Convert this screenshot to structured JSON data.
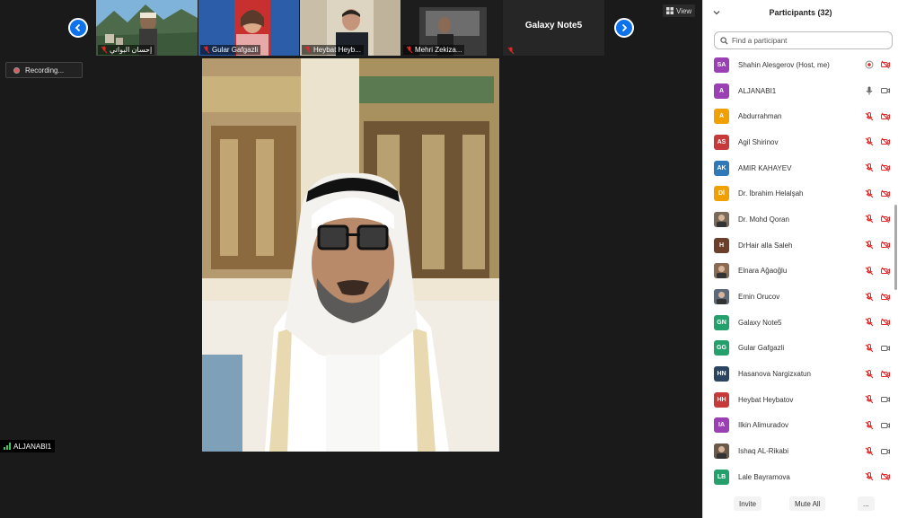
{
  "view_button": {
    "label": "View"
  },
  "recording": {
    "label": "Recording..."
  },
  "thumbnails": [
    {
      "name": "إحسان البواتي"
    },
    {
      "name": "Gular Gafgazli"
    },
    {
      "name": "Heybat Heyb..."
    },
    {
      "name": "Mehri Zekiza..."
    },
    {
      "name": "Galaxy Note5"
    }
  ],
  "main_video": {
    "speaker": "ALJANABI1"
  },
  "panel": {
    "title": "Participants (32)",
    "search_placeholder": "Find a participant",
    "participants": [
      {
        "initials": "SA",
        "name": "Shahin Alesgerov (Host, me)",
        "color": "#9b3fb5",
        "mic": "share",
        "cam": "off"
      },
      {
        "initials": "A",
        "name": "ALJANABI1",
        "color": "#9b3fb5",
        "mic": "on",
        "cam": "on"
      },
      {
        "initials": "A",
        "name": "Abdurrahman",
        "color": "#f0a000",
        "mic": "off",
        "cam": "off"
      },
      {
        "initials": "AS",
        "name": "Agil Shirinov",
        "color": "#c63a3a",
        "mic": "off",
        "cam": "off"
      },
      {
        "initials": "AK",
        "name": "AMIR KAHAYEV",
        "color": "#2f79b8",
        "mic": "off",
        "cam": "off"
      },
      {
        "initials": "Dİ",
        "name": "Dr. İbrahim Helalşah",
        "color": "#f0a000",
        "mic": "off",
        "cam": "off"
      },
      {
        "initials": "",
        "name": "Dr. Mohd Qoran",
        "color": "#7a6a5a",
        "mic": "off",
        "cam": "off"
      },
      {
        "initials": "H",
        "name": "DrHair alla Saleh",
        "color": "#6b3f2a",
        "mic": "off",
        "cam": "off"
      },
      {
        "initials": "",
        "name": "Elnara Ağaoğlu",
        "color": "#8a6a50",
        "mic": "off",
        "cam": "off"
      },
      {
        "initials": "",
        "name": "Emin Orucov",
        "color": "#5a6a7a",
        "mic": "off",
        "cam": "off"
      },
      {
        "initials": "GN",
        "name": "Galaxy Note5",
        "color": "#24a06c",
        "mic": "off",
        "cam": "off"
      },
      {
        "initials": "GG",
        "name": "Gular Gafgazli",
        "color": "#24a06c",
        "mic": "off",
        "cam": "on"
      },
      {
        "initials": "HN",
        "name": "Hasanova Nargizxatun",
        "color": "#2b4560",
        "mic": "off",
        "cam": "off"
      },
      {
        "initials": "HH",
        "name": "Heybat Heybatov",
        "color": "#c63a3a",
        "mic": "off",
        "cam": "on"
      },
      {
        "initials": "IA",
        "name": "Ilkin Alimuradov",
        "color": "#9b3fb5",
        "mic": "off",
        "cam": "on"
      },
      {
        "initials": "",
        "name": "Ishaq AL-Rikabi",
        "color": "#6a5a4a",
        "mic": "off",
        "cam": "on"
      },
      {
        "initials": "LB",
        "name": "Lale Bayramova",
        "color": "#24a06c",
        "mic": "off",
        "cam": "off"
      }
    ],
    "footer": {
      "invite": "Invite",
      "mute_all": "Mute All",
      "more": "..."
    }
  },
  "colors": {
    "accent": "#0e72ed",
    "muted_red": "#e02828",
    "panel_bg": "#ffffff",
    "meeting_bg": "#1a1a1a"
  }
}
